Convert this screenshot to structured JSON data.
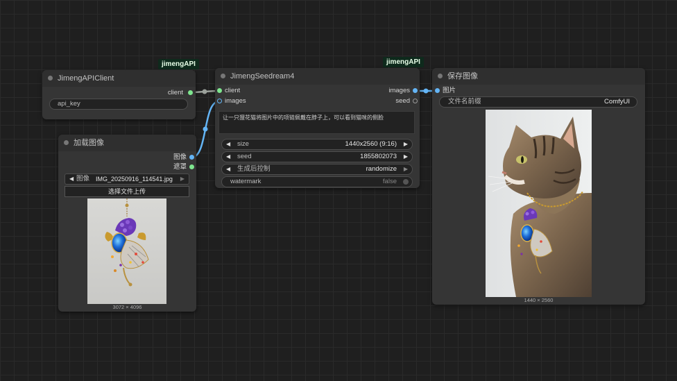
{
  "nodes": {
    "client": {
      "badge": "jimengAPI",
      "title": "JimengAPIClient",
      "output_client": "client",
      "api_key_label": "api_key"
    },
    "seedream": {
      "badge": "jimengAPI",
      "title": "JimengSeedream4",
      "input_client": "client",
      "input_images": "images",
      "output_images": "images",
      "output_seed": "seed",
      "prompt": "让一只狸花猫将图片中的项链佩戴在脖子上，可以看到猫咪的侧脸",
      "size_label": "size",
      "size_value": "1440x2560 (9:16)",
      "seed_label": "seed",
      "seed_value": "1855802073",
      "control_label": "生成后控制",
      "control_value": "randomize",
      "watermark_label": "watermark",
      "watermark_value": "false"
    },
    "load_image": {
      "title": "加载图像",
      "output_image": "图像",
      "output_mask": "遮罩",
      "image_label": "图像",
      "image_value": "IMG_20250916_114541.jpg",
      "upload_button": "选择文件上传",
      "dimensions": "3072 × 4096"
    },
    "save_image": {
      "title": "保存图像",
      "input_images": "图片",
      "prefix_label": "文件名前缀",
      "prefix_value": "ComfyUI",
      "dimensions": "1440 × 2560"
    }
  },
  "colors": {
    "canvas": "#1f1f1f",
    "node_body": "#353535",
    "client_port": "#7ee68f",
    "image_port": "#64b5f6",
    "badge_bg": "#0e2a1c"
  }
}
